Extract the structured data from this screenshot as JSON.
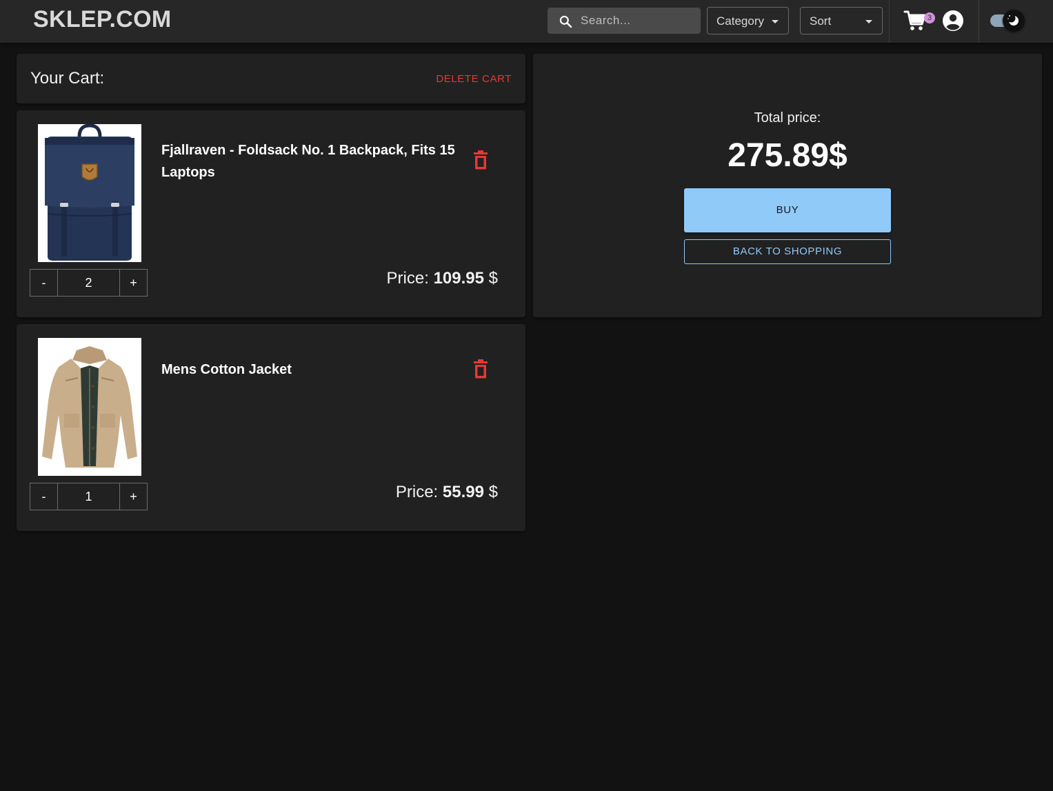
{
  "header": {
    "logo": "SKLEP.COM",
    "search_placeholder": "Search...",
    "category_label": "Category",
    "sort_label": "Sort",
    "cart_count": "3",
    "icons": [
      "search-icon",
      "cart-icon",
      "account-icon",
      "theme-toggle"
    ]
  },
  "cart": {
    "title": "Your Cart:",
    "delete_label": "DELETE CART",
    "items": [
      {
        "name": "Fjallraven - Foldsack No. 1 Backpack, Fits 15 Laptops",
        "quantity": "2",
        "price_prefix": "Price:",
        "price": "109.95",
        "currency": "$",
        "image": "backpack"
      },
      {
        "name": "Mens Cotton Jacket",
        "quantity": "1",
        "price_prefix": "Price:",
        "price": "55.99",
        "currency": "$",
        "image": "jacket"
      }
    ],
    "minus_label": "-",
    "plus_label": "+"
  },
  "summary": {
    "label": "Total price:",
    "total": "275.89$",
    "buy_label": "BUY",
    "back_label": "BACK TO SHOPPING"
  },
  "colors": {
    "background": "#121212",
    "surface": "#212121",
    "accent": "#90caf9",
    "danger": "#e53935",
    "badge": "#ce93d8"
  }
}
